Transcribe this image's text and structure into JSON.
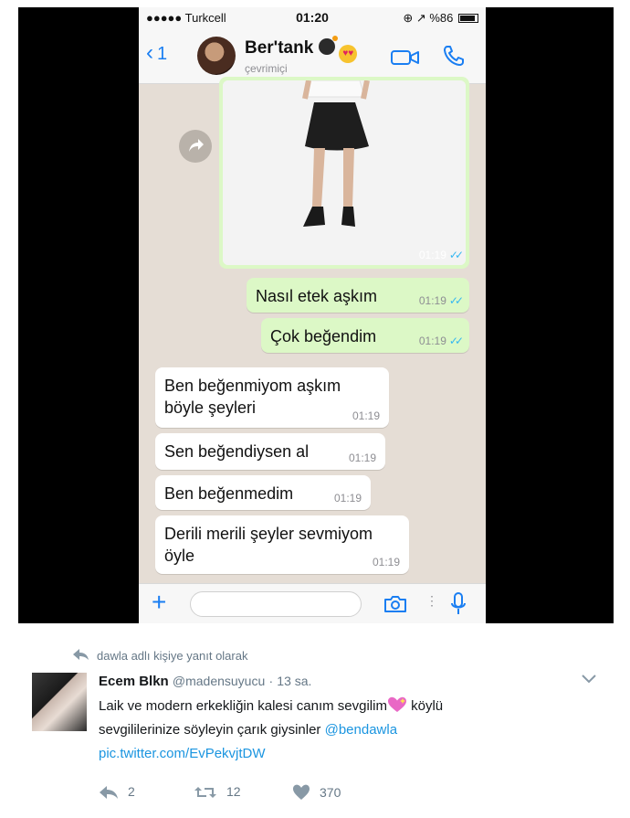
{
  "statusbar": {
    "carrier": "●●●●● Turkcell",
    "time": "01:20",
    "battery_text": "⊕ ↗ %86"
  },
  "header": {
    "back_count": "1",
    "contact_name": "Ber'tank",
    "contact_status": "çevrimiçi"
  },
  "image_message": {
    "time": "01:19"
  },
  "messages": [
    {
      "lines": [
        "Nasıl etek aşkım"
      ],
      "time": "01:19"
    },
    {
      "lines": [
        "Çok beğendim"
      ],
      "time": "01:19"
    },
    {
      "lines": [
        "Ben beğenmiyom aşkım",
        "böyle şeyleri"
      ],
      "time": "01:19"
    },
    {
      "lines": [
        "Sen beğendiysen al"
      ],
      "time": "01:19"
    },
    {
      "lines": [
        "Ben beğenmedim"
      ],
      "time": "01:19"
    },
    {
      "lines": [
        "Derili merili şeyler sevmiyom",
        "öyle"
      ],
      "time": "01:19"
    }
  ],
  "tweet": {
    "reply_context": "dawla adlı kişiye yanıt olarak",
    "name": "Ecem Blkn",
    "handle": "@madensuyucu",
    "separator": "·",
    "time": "13 sa.",
    "text_part1": "Laik ve modern erkekliğin kalesi canım sevgilim",
    "text_part2": " köylü",
    "text_line2": "sevgililerinize söyleyin çarık giysinler ",
    "mention": "@bendawla",
    "link": "pic.twitter.com/EvPekvjtDW",
    "reply_count": "2",
    "retweet_count": "12",
    "like_count": "370"
  },
  "colors": {
    "whatsapp_out": "#dcf8c6",
    "whatsapp_in": "#ffffff",
    "ios_blue": "#1a7ef2",
    "twitter_blue": "#1b95e0",
    "twitter_gray": "#657786"
  }
}
